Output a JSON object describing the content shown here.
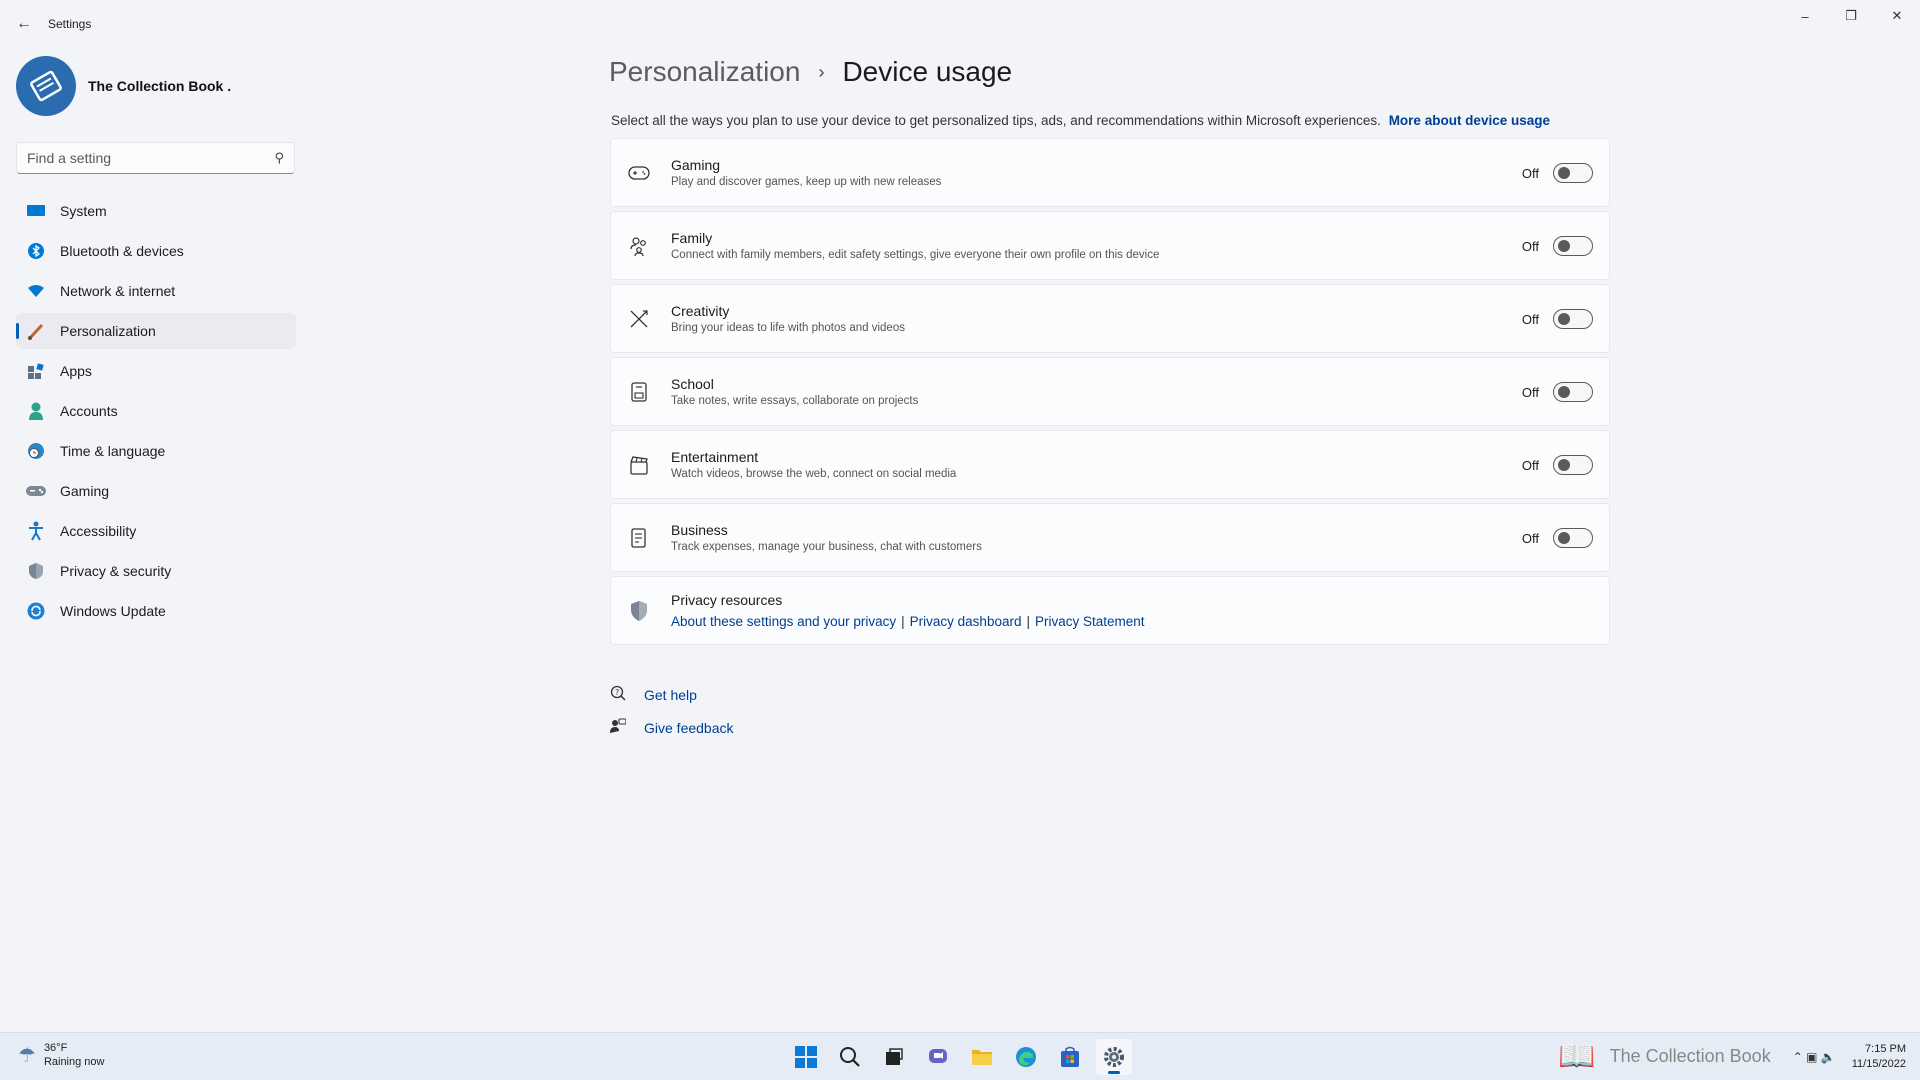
{
  "window": {
    "title": "Settings",
    "controls": {
      "minimize": "–",
      "maximize": "❐",
      "close": "✕"
    }
  },
  "profile": {
    "name": "The Collection Book ."
  },
  "search": {
    "placeholder": "Find a setting"
  },
  "sidebar": {
    "items": [
      {
        "label": "System",
        "icon": "system-icon",
        "color": "#0067c0"
      },
      {
        "label": "Bluetooth & devices",
        "icon": "bluetooth-icon",
        "color": "#0078d4"
      },
      {
        "label": "Network & internet",
        "icon": "wifi-icon",
        "color": "#0078d4"
      },
      {
        "label": "Personalization",
        "icon": "brush-icon",
        "color": "#c4652b",
        "active": true
      },
      {
        "label": "Apps",
        "icon": "apps-icon",
        "color": "#5a6f8a"
      },
      {
        "label": "Accounts",
        "icon": "person-icon",
        "color": "#2aa38b"
      },
      {
        "label": "Time & language",
        "icon": "globe-clock-icon",
        "color": "#2a86c9"
      },
      {
        "label": "Gaming",
        "icon": "controller-icon",
        "color": "#7d8896"
      },
      {
        "label": "Accessibility",
        "icon": "accessibility-icon",
        "color": "#1a78c2"
      },
      {
        "label": "Privacy & security",
        "icon": "shield-icon",
        "color": "#7a8494"
      },
      {
        "label": "Windows Update",
        "icon": "update-icon",
        "color": "#1f7fd1"
      }
    ]
  },
  "breadcrumb": {
    "parent": "Personalization",
    "separator": "›",
    "current": "Device usage"
  },
  "description": {
    "text": "Select all the ways you plan to use your device to get personalized tips, ads, and recommendations within Microsoft experiences.",
    "link": "More about device usage"
  },
  "settings": [
    {
      "title": "Gaming",
      "subtitle": "Play and discover games, keep up with new releases",
      "state": "Off",
      "icon": "gamepad-icon"
    },
    {
      "title": "Family",
      "subtitle": "Connect with family members, edit safety settings, give everyone their own profile on this device",
      "state": "Off",
      "icon": "family-icon"
    },
    {
      "title": "Creativity",
      "subtitle": "Bring your ideas to life with photos and videos",
      "state": "Off",
      "icon": "pen-ruler-icon"
    },
    {
      "title": "School",
      "subtitle": "Take notes, write essays, collaborate on projects",
      "state": "Off",
      "icon": "notebook-icon"
    },
    {
      "title": "Entertainment",
      "subtitle": "Watch videos, browse the web, connect on social media",
      "state": "Off",
      "icon": "clapperboard-icon"
    },
    {
      "title": "Business",
      "subtitle": "Track expenses, manage your business, chat with customers",
      "state": "Off",
      "icon": "receipt-icon"
    }
  ],
  "privacy": {
    "title": "Privacy resources",
    "links": [
      "About these settings and your privacy",
      "Privacy dashboard",
      "Privacy Statement"
    ],
    "separator": "|"
  },
  "help": {
    "get_help": "Get help",
    "give_feedback": "Give feedback"
  },
  "taskbar": {
    "weather": {
      "temp": "36°F",
      "condition": "Raining now"
    },
    "apps": [
      "start-icon",
      "search-icon",
      "task-view-icon",
      "chat-icon",
      "file-explorer-icon",
      "edge-icon",
      "store-icon",
      "settings-icon"
    ],
    "watermark": "The Collection Book",
    "clock": {
      "time": "7:15 PM",
      "date": "11/15/2022"
    }
  },
  "colors": {
    "accent": "#005fb8",
    "link": "#003e92",
    "background": "#f2f4f8"
  }
}
